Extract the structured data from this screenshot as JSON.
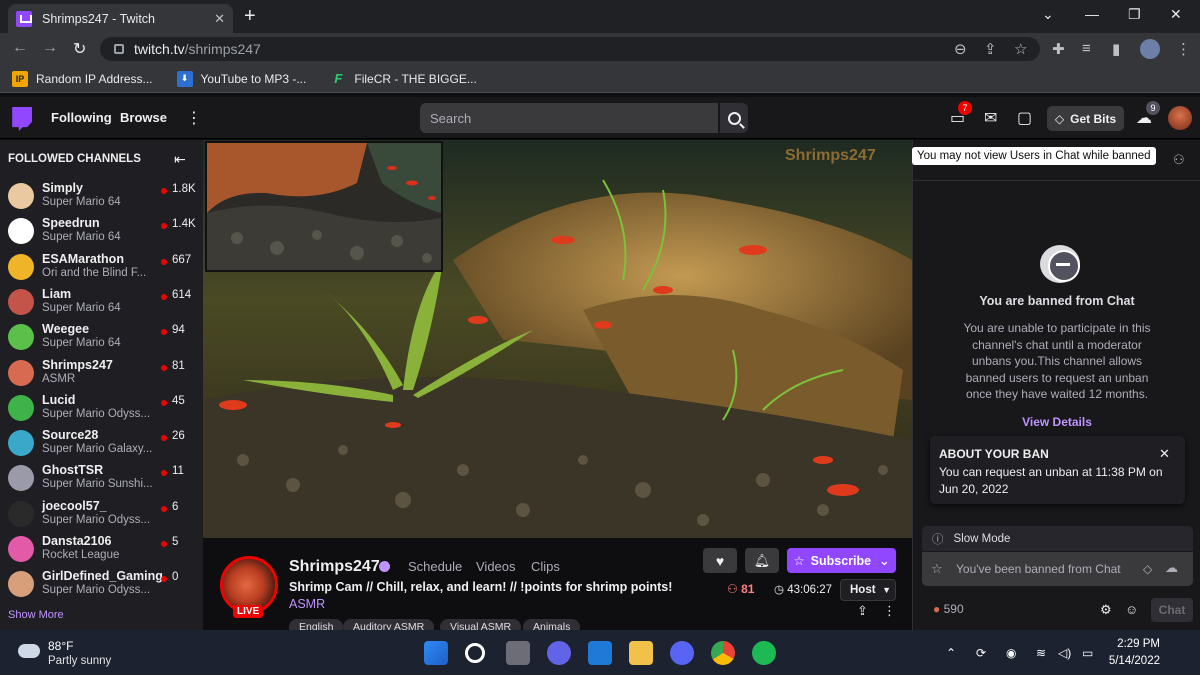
{
  "browser": {
    "tab_title": "Shrimps247 - Twitch",
    "tab_close": "✕",
    "new_tab": "+",
    "url_host": "twitch.tv",
    "url_path": "/shrimps247",
    "bookmarks": [
      {
        "label": "Random IP Address...",
        "icon": "IP"
      },
      {
        "label": "YouTube to MP3 -...",
        "icon": "⬇"
      },
      {
        "label": "FileCR - THE BIGGE...",
        "icon": "F"
      }
    ]
  },
  "twitch_nav": {
    "following": "Following",
    "browse": "Browse",
    "search_placeholder": "Search",
    "notifications_count": "7",
    "get_bits": "Get Bits",
    "bits_count": "9"
  },
  "sidebar": {
    "title": "FOLLOWED CHANNELS",
    "show_more": "Show More",
    "channels": [
      {
        "name": "Simply",
        "game": "Super Mario 64",
        "viewers": "1.8K",
        "color": "#e8c9a0"
      },
      {
        "name": "Speedrun",
        "game": "Super Mario 64",
        "viewers": "1.4K",
        "color": "#ffffff"
      },
      {
        "name": "ESAMarathon",
        "game": "Ori and the Blind F...",
        "viewers": "667",
        "color": "#f0b429"
      },
      {
        "name": "Liam",
        "game": "Super Mario 64",
        "viewers": "614",
        "color": "#c4534a"
      },
      {
        "name": "Weegee",
        "game": "Super Mario 64",
        "viewers": "94",
        "color": "#5bbf4a"
      },
      {
        "name": "Shrimps247",
        "game": "ASMR",
        "viewers": "81",
        "color": "#d86a52"
      },
      {
        "name": "Lucid",
        "game": "Super Mario Odyss...",
        "viewers": "45",
        "color": "#3fb34a"
      },
      {
        "name": "Source28",
        "game": "Super Mario Galaxy...",
        "viewers": "26",
        "color": "#3aa8c8"
      },
      {
        "name": "GhostTSR",
        "game": "Super Mario Sunshi...",
        "viewers": "11",
        "color": "#9a9aa8"
      },
      {
        "name": "joecool57_",
        "game": "Super Mario Odyss...",
        "viewers": "6",
        "color": "#2a2a2a"
      },
      {
        "name": "Dansta2106",
        "game": "Rocket League",
        "viewers": "5",
        "color": "#e25aa8"
      },
      {
        "name": "GirlDefined_Gaming",
        "game": "Super Mario Odyss...",
        "viewers": "0",
        "color": "#d8a07a"
      }
    ]
  },
  "video": {
    "watermark": "Shrimps247"
  },
  "channel": {
    "name": "Shrimps247",
    "live": "LIVE",
    "tabs": [
      "Schedule",
      "Videos",
      "Clips"
    ],
    "title": "Shrimp Cam // Chill, relax, and learn! // !points for shrimp points!",
    "category": "ASMR",
    "tags": [
      "English",
      "Auditory ASMR",
      "Visual ASMR",
      "Animals"
    ],
    "subscribe": "Subscribe",
    "viewers": "81",
    "uptime": "43:06:27",
    "host": "Host"
  },
  "chat": {
    "tooltip": "You may not view Users in Chat while banned",
    "banned_title": "You are banned from Chat",
    "banned_desc": "You are unable to participate in this channel's chat until a moderator unbans you.This channel allows banned users to request an unban once they have waited 12 months.",
    "view_details": "View Details",
    "about_title": "ABOUT YOUR BAN",
    "about_text": "You can request an unban at 11:38 PM on Jun 20, 2022",
    "slow_mode": "Slow Mode",
    "input_placeholder": "You've been banned from Chat",
    "points": "590",
    "chat_button": "Chat"
  },
  "taskbar": {
    "temp": "88°F",
    "sky": "Partly sunny",
    "time": "2:29 PM",
    "date": "5/14/2022"
  }
}
